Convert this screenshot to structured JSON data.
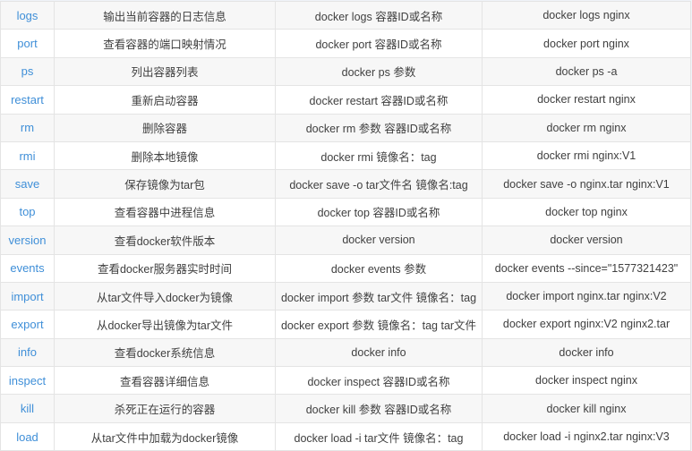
{
  "rows": [
    {
      "command": "logs",
      "description": "输出当前容器的日志信息",
      "syntax": "docker logs 容器ID或名称",
      "example": "docker logs nginx"
    },
    {
      "command": "port",
      "description": "查看容器的端口映射情况",
      "syntax": "docker port 容器ID或名称",
      "example": "docker port nginx"
    },
    {
      "command": "ps",
      "description": "列出容器列表",
      "syntax": "docker ps 参数",
      "example": "docker ps -a"
    },
    {
      "command": "restart",
      "description": "重新启动容器",
      "syntax": "docker restart 容器ID或名称",
      "example": "docker restart nginx"
    },
    {
      "command": "rm",
      "description": "删除容器",
      "syntax": "docker rm 参数 容器ID或名称",
      "example": "docker rm nginx"
    },
    {
      "command": "rmi",
      "description": "删除本地镜像",
      "syntax": "docker rmi 镜像名：tag",
      "example": "docker rmi nginx:V1"
    },
    {
      "command": "save",
      "description": "保存镜像为tar包",
      "syntax": "docker save -o tar文件名 镜像名:tag",
      "example": "docker save -o nginx.tar nginx:V1"
    },
    {
      "command": "top",
      "description": "查看容器中进程信息",
      "syntax": "docker top 容器ID或名称",
      "example": "docker top nginx"
    },
    {
      "command": "version",
      "description": "查看docker软件版本",
      "syntax": "docker version",
      "example": "docker version"
    },
    {
      "command": "events",
      "description": "查看docker服务器实时时间",
      "syntax": "docker events 参数",
      "example": "docker events --since=\"1577321423\""
    },
    {
      "command": "import",
      "description": "从tar文件导入docker为镜像",
      "syntax": "docker import 参数 tar文件 镜像名：tag",
      "example": "docker import nginx.tar nginx:V2"
    },
    {
      "command": "export",
      "description": "从docker导出镜像为tar文件",
      "syntax": "docker export 参数 镜像名：tag tar文件",
      "example": "docker export nginx:V2 nginx2.tar"
    },
    {
      "command": "info",
      "description": "查看docker系统信息",
      "syntax": "docker info",
      "example": "docker info"
    },
    {
      "command": "inspect",
      "description": "查看容器详细信息",
      "syntax": "docker inspect 容器ID或名称",
      "example": "docker inspect nginx"
    },
    {
      "command": "kill",
      "description": "杀死正在运行的容器",
      "syntax": "docker kill 参数 容器ID或名称",
      "example": "docker kill nginx"
    },
    {
      "command": "load",
      "description": "从tar文件中加载为docker镜像",
      "syntax": "docker load -i tar文件 镜像名：tag",
      "example": "docker load -i nginx2.tar nginx:V3"
    }
  ],
  "colors": {
    "command_link": "#3f8fd8",
    "text": "#404040",
    "stripe": "#f7f7f7",
    "border": "#e4e4e4"
  }
}
